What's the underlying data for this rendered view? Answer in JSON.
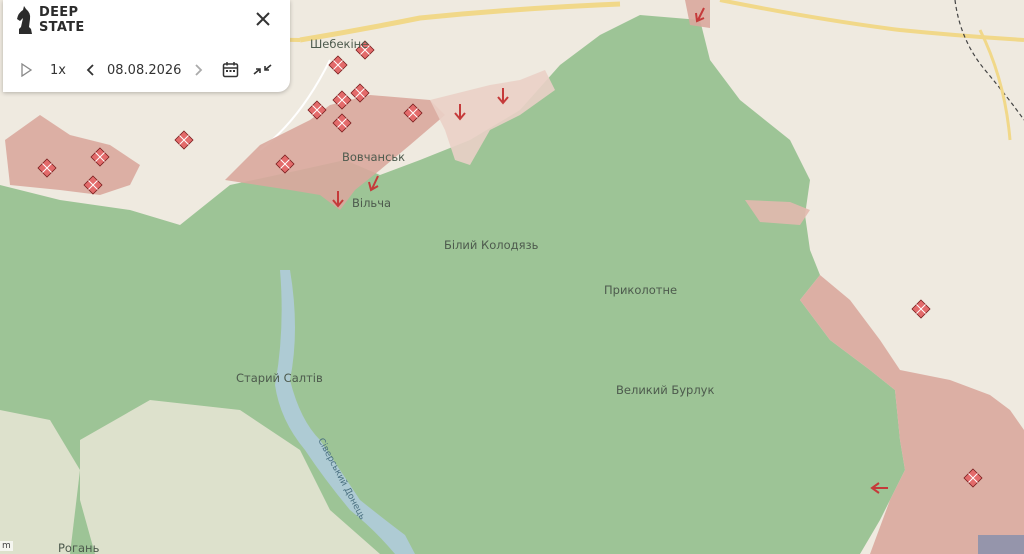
{
  "panel": {
    "logo_line1": "DEEP",
    "logo_line2": "STATE",
    "speed": "1x",
    "date": "08.08.2026"
  },
  "places": {
    "shebekino": "Шебекіне",
    "vovchansk": "Вовчанськ",
    "vilcha": "Вільча",
    "bilyi_kolodiaz": "Білий Колодязь",
    "prykolotne": "Приколотне",
    "staryi_saltiv": "Старий Салтів",
    "velykyi_burluk": "Великий Бурлук",
    "rohan": "Рогань",
    "river": "Сіверський Донець"
  },
  "attribution": "m",
  "colors": {
    "liberated": "#9dc496",
    "occupied_gray_zone": "#d9a89d",
    "base_map": "#efeae0",
    "assault_marker": "#e05a5a"
  },
  "icons": {
    "logo": "chess-knight-icon",
    "close": "close-icon",
    "play": "play-icon",
    "prev": "chevron-left-icon",
    "next": "chevron-right-icon",
    "calendar": "calendar-icon",
    "collapse": "collapse-arrows-icon",
    "attack": "arrow-icon",
    "combat": "diamond-grid-icon"
  }
}
